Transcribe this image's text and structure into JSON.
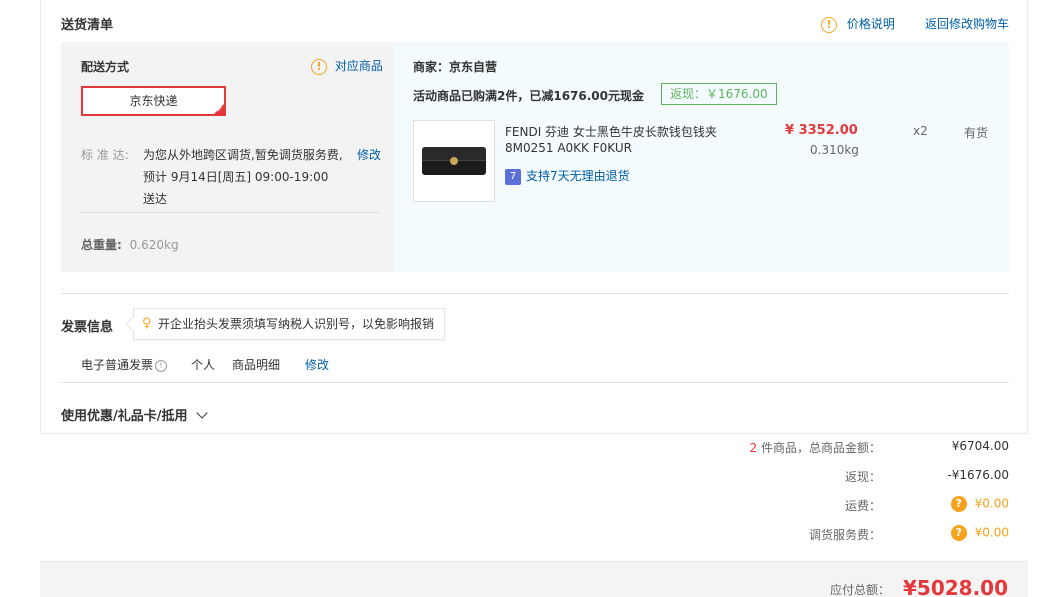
{
  "shipping_list": {
    "title": "送货清单",
    "price_note_icon": "warning-icon",
    "price_note": "价格说明",
    "back_to_cart": "返回修改购物车"
  },
  "delivery": {
    "method_label": "配送方式",
    "match_goods_icon": "warning-icon",
    "match_goods": "对应商品",
    "selected_method": "京东快递",
    "standard_label": "标 准 达:",
    "standard_line1": "为您从外地跨区调货,暂免调货服务费,",
    "edit": "修改",
    "standard_line2": "预计 9月14日[周五] 09:00-19:00",
    "standard_line3": "送达",
    "weight_label": "总重量:",
    "weight_value": "0.620kg"
  },
  "merchant": {
    "seller": "商家：京东自营",
    "promo": "活动商品已购满2件，已减1676.00元现金",
    "rebate_tag": "返现：￥1676.00"
  },
  "product": {
    "image_icon": "wallet-image",
    "name_line1": "FENDI 芬迪 女士黑色牛皮长款钱包钱夹",
    "name_line2": "8M0251 A0KK F0KUR",
    "price": "¥ 3352.00",
    "weight": "0.310kg",
    "quantity": "x2",
    "stock": "有货",
    "return_icon": "seven-day-return-icon",
    "return_badge": "7",
    "return_policy": "支持7天无理由退货"
  },
  "invoice": {
    "title": "发票信息",
    "tip_icon": "lightbulb-icon",
    "tip": "开企业抬头发票须填写纳税人识别号，以免影响报销",
    "type": "电子普通发票",
    "type_info_icon": "info-icon",
    "holder": "个人",
    "content": "商品明细",
    "edit": "修改"
  },
  "coupons": {
    "title": "使用优惠/礼品卡/抵用",
    "expand_icon": "chevron-down-icon"
  },
  "summary": {
    "item_count": "2",
    "items_label": "件商品，总商品金额：",
    "items_total": "¥6704.00",
    "rebate_label": "返现：",
    "rebate_value": "-¥1676.00",
    "shipping_label": "运费：",
    "shipping_value": "¥0.00",
    "transfer_label": "调货服务费：",
    "transfer_value": "¥0.00",
    "help_icon": "question-icon",
    "help_glyph": "?",
    "payable_label": "应付总额：",
    "payable_value": "¥5028.00"
  },
  "colors": {
    "accent_red": "#e4393c",
    "link_blue": "#005ea7",
    "rebate_green": "#5fb35e",
    "warning_orange": "#f7a21b"
  }
}
